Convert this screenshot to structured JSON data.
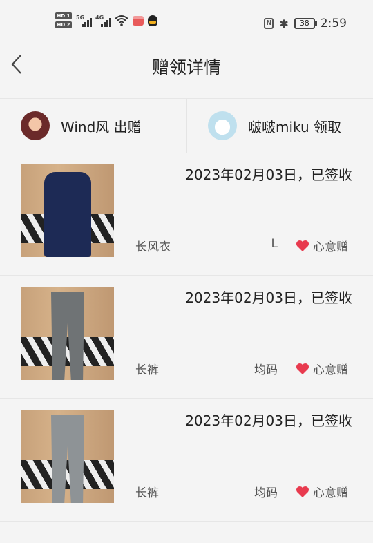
{
  "status": {
    "time": "2:59",
    "battery": "38",
    "hd1": "HD 1",
    "hd2": "HD 2",
    "net1": "5G",
    "net2": "4G"
  },
  "header": {
    "title": "赠领详情"
  },
  "users": {
    "giver": "Wind风 出赠",
    "receiver": "啵啵miku 领取"
  },
  "items": [
    {
      "date": "2023年02月03日，已签收",
      "name": "长风衣",
      "size": "L",
      "tag": "心意赠"
    },
    {
      "date": "2023年02月03日，已签收",
      "name": "长裤",
      "size": "均码",
      "tag": "心意赠"
    },
    {
      "date": "2023年02月03日，已签收",
      "name": "长裤",
      "size": "均码",
      "tag": "心意赠"
    }
  ],
  "colors": {
    "heart": "#e83a4e",
    "background": "#f4f4f4"
  }
}
